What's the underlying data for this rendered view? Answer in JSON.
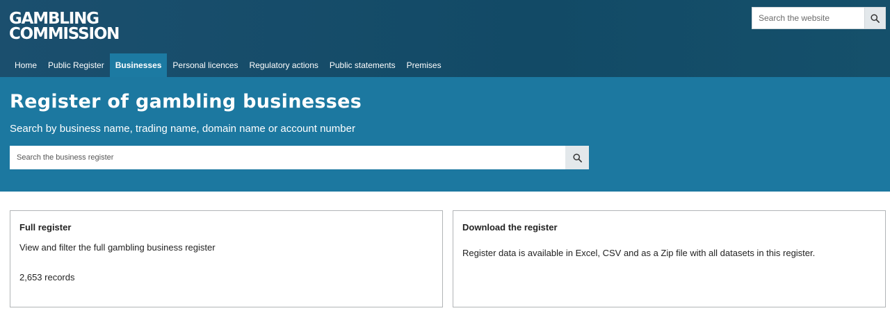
{
  "header": {
    "logo_line1": "GAMBLING",
    "logo_line2": "COMMISSION",
    "site_search_placeholder": "Search the website"
  },
  "nav": {
    "items": [
      "Home",
      "Public Register",
      "Businesses",
      "Personal licences",
      "Regulatory actions",
      "Public statements",
      "Premises"
    ],
    "active": "Businesses"
  },
  "hero": {
    "title": "Register of gambling businesses",
    "subtitle": "Search by business name, trading name, domain name or account number",
    "search_placeholder": "Search the business register"
  },
  "cards": [
    {
      "title": "Full register",
      "description": "View and filter the full gambling business register",
      "records": "2,653 records"
    },
    {
      "title": "Download the register",
      "description": "Register data is available in Excel, CSV and as a Zip file with all datasets in this register."
    }
  ],
  "colors": {
    "header_bg": "#124a66",
    "hero_bg": "#1c78a0",
    "active_nav": "#1c7aa2"
  },
  "icons": {
    "site_search": "search-icon",
    "register_search": "search-icon"
  }
}
